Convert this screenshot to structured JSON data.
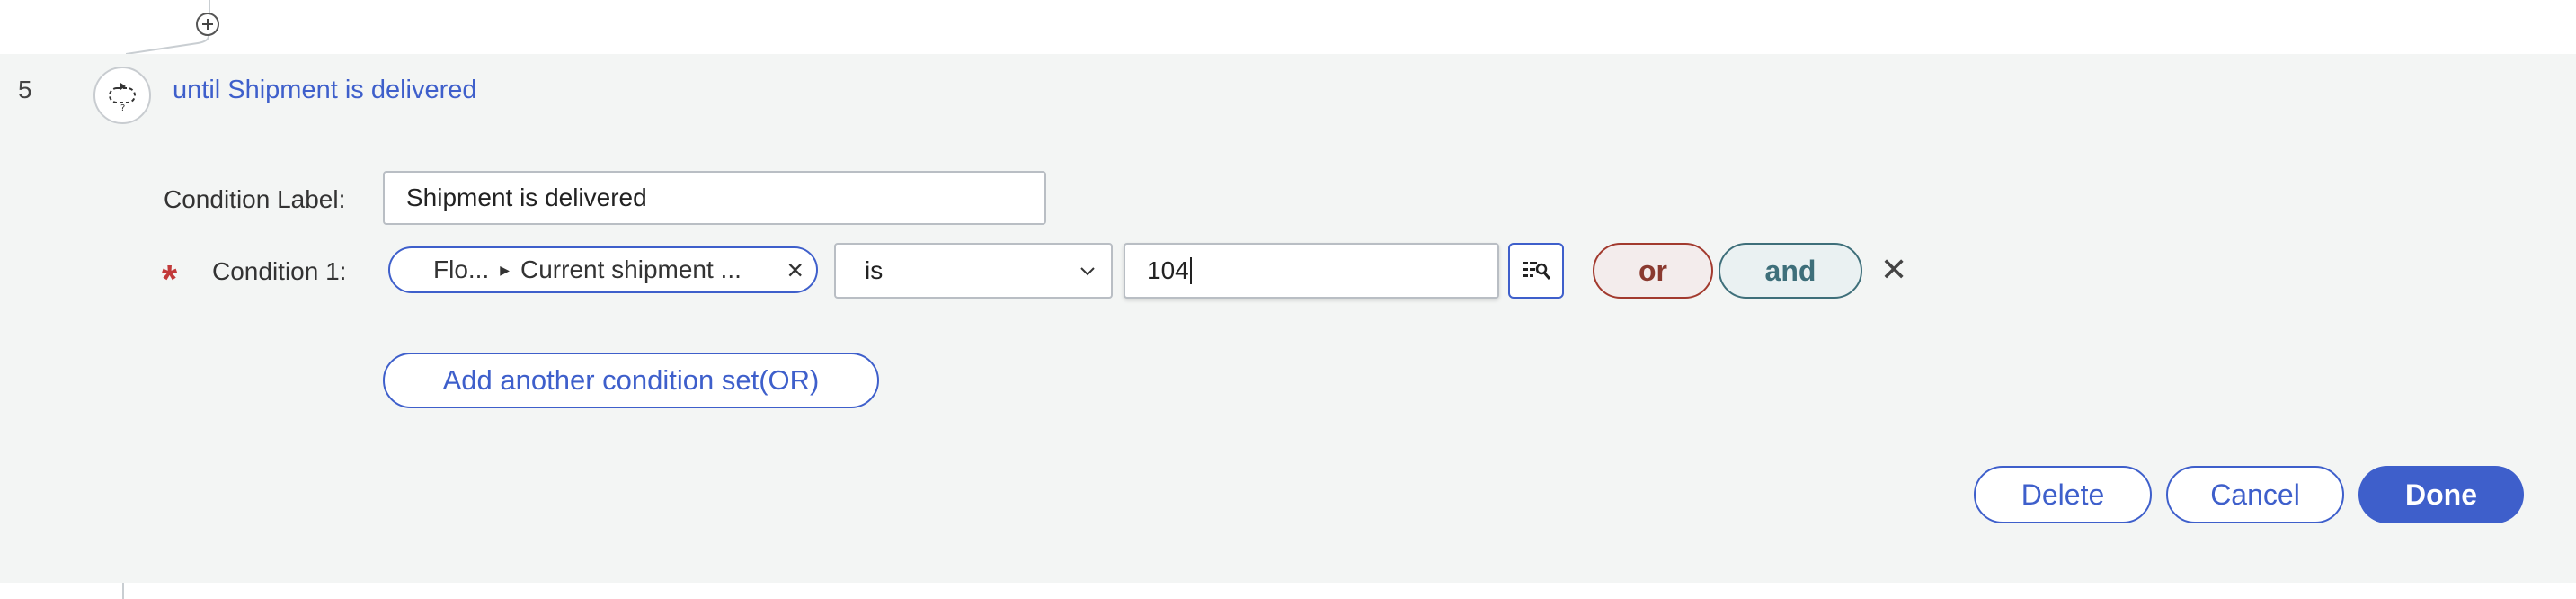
{
  "step": {
    "number": "5",
    "title": "until Shipment is delivered"
  },
  "condition_label": {
    "label": "Condition Label:",
    "value": "Shipment is delivered"
  },
  "condition1": {
    "required_marker": "*",
    "label": "Condition 1:",
    "field_path": [
      "Flo...",
      "Current shipment ..."
    ],
    "operator": "is",
    "value": "104"
  },
  "buttons": {
    "or": "or",
    "and": "and",
    "add_condition_set": "Add another condition set(OR)",
    "delete": "Delete",
    "cancel": "Cancel",
    "done": "Done"
  },
  "icons": {
    "add_step": "plus-circle-icon",
    "loop": "loop-icon",
    "clear": "close-icon",
    "chevron": "chevron-down-icon",
    "picker": "data-picker-icon",
    "remove": "close-icon"
  },
  "colors": {
    "accent": "#3e5fcb",
    "or": "#a23a2e",
    "and": "#3e6f7a",
    "required": "#c23a3a",
    "panel_bg": "#f3f5f4"
  }
}
